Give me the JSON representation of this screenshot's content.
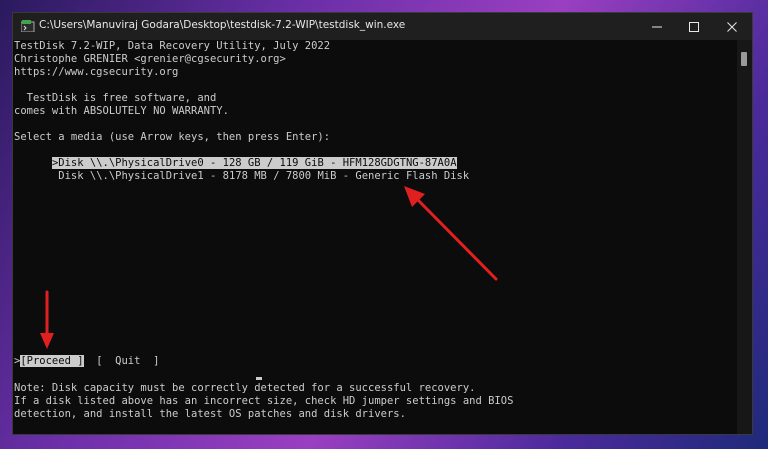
{
  "window": {
    "title": "C:\\Users\\Manuviraj Godara\\Desktop\\testdisk-7.2-WIP\\testdisk_win.exe"
  },
  "icons": {
    "app": "terminal-app-icon",
    "minimize": "minimize-icon",
    "maximize": "maximize-icon",
    "close": "close-icon"
  },
  "console": {
    "header_line1": "TestDisk 7.2-WIP, Data Recovery Utility, July 2022",
    "header_line2": "Christophe GRENIER <grenier@cgsecurity.org>",
    "header_line3": "https://www.cgsecurity.org",
    "license_line1": "  TestDisk is free software, and",
    "license_line2": "comes with ABSOLUTELY NO WARRANTY.",
    "prompt": "Select a media (use Arrow keys, then press Enter):",
    "media_list": [
      ">Disk \\\\.\\PhysicalDrive0 - 128 GB / 119 GiB - HFM128GDGTNG-87A0A",
      " Disk \\\\.\\PhysicalDrive1 - 8178 MB / 7800 MiB - Generic Flash Disk"
    ],
    "action_selected_marker": ">",
    "action_proceed": "[Proceed ]",
    "action_quit": "  [  Quit  ]",
    "note_line1": "Note: Disk capacity must be correctly detected for a successful recovery.",
    "note_line2": "If a disk listed above has an incorrect size, check HD jumper settings and BIOS",
    "note_line3": "detection, and install the latest OS patches and disk drivers."
  },
  "colors": {
    "console_bg": "#0c0c0c",
    "console_text": "#cccccc",
    "arrow": "#e02020"
  }
}
